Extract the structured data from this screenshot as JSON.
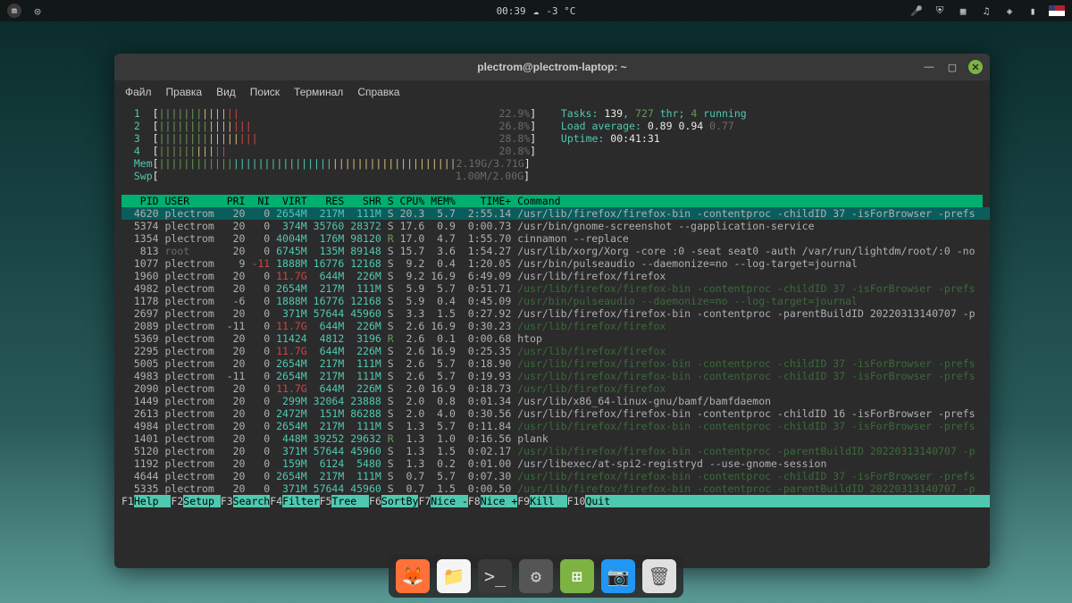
{
  "panel": {
    "time": "00:39",
    "weather": "-3 °C"
  },
  "window": {
    "title": "plectrom@plectrom-laptop: ~",
    "menu": [
      "Файл",
      "Правка",
      "Вид",
      "Поиск",
      "Терминал",
      "Справка"
    ]
  },
  "htop": {
    "cpus": [
      {
        "id": "1",
        "pct": "22.9%"
      },
      {
        "id": "2",
        "pct": "26.8%"
      },
      {
        "id": "3",
        "pct": "28.8%"
      },
      {
        "id": "4",
        "pct": "20.8%"
      }
    ],
    "mem_label": "Mem",
    "mem_used": "2.19G",
    "mem_total": "3.71G",
    "swp_label": "Swp",
    "swp_used": "1.00M",
    "swp_total": "2.00G",
    "tasks_label": "Tasks:",
    "tasks": "139",
    "threads": "727",
    "thr_label": "thr;",
    "running": "4",
    "running_label": "running",
    "la_label": "Load average:",
    "la1": "0.89",
    "la2": "0.94",
    "la3": "0.77",
    "uptime_label": "Uptime:",
    "uptime": "00:41:31",
    "header": [
      "  PID",
      "USER    ",
      "PRI",
      " NI",
      " VIRT",
      "  RES",
      "  SHR",
      "S",
      "CPU%",
      "MEM%",
      "  TIME+",
      "Command"
    ],
    "rows": [
      {
        "sel": true,
        "pid": "4620",
        "user": "plectrom",
        "pri": "20",
        "ni": "0",
        "virt": "2654M",
        "res": "217M",
        "shr": "111M",
        "s": "S",
        "cpu": "20.3",
        "mem": "5.7",
        "time": "2:55.14",
        "cmd": "/usr/lib/firefox/firefox-bin -contentproc -childID 37 -isForBrowser -prefs",
        "dim": false
      },
      {
        "pid": "5374",
        "user": "plectrom",
        "pri": "20",
        "ni": "0",
        "virt": "374M",
        "res": "35760",
        "shr": "28372",
        "s": "S",
        "cpu": "17.6",
        "mem": "0.9",
        "time": "0:00.73",
        "cmd": "/usr/bin/gnome-screenshot --gapplication-service"
      },
      {
        "pid": "1354",
        "user": "plectrom",
        "pri": "20",
        "ni": "0",
        "virt": "4004M",
        "res": "176M",
        "shr": "98120",
        "s": "R",
        "cpu": "17.0",
        "mem": "4.7",
        "time": "1:55.70",
        "cmd": "cinnamon --replace"
      },
      {
        "pid": "813",
        "user": "root",
        "pri": "20",
        "ni": "0",
        "virt": "6745M",
        "res": "135M",
        "shr": "89148",
        "s": "S",
        "cpu": "15.7",
        "mem": "3.6",
        "time": "1:54.27",
        "cmd": "/usr/lib/xorg/Xorg -core :0 -seat seat0 -auth /var/run/lightdm/root/:0 -no",
        "dimuser": true
      },
      {
        "pid": "1077",
        "user": "plectrom",
        "pri": "9",
        "ni": "-11",
        "virt": "1888M",
        "res": "16776",
        "shr": "12168",
        "s": "S",
        "cpu": "9.2",
        "mem": "0.4",
        "time": "1:20.05",
        "cmd": "/usr/bin/pulseaudio --daemonize=no --log-target=journal",
        "nired": true
      },
      {
        "pid": "1960",
        "user": "plectrom",
        "pri": "20",
        "ni": "0",
        "virt": "11.7G",
        "res": "644M",
        "shr": "226M",
        "s": "S",
        "cpu": "9.2",
        "mem": "16.9",
        "time": "6:49.09",
        "cmd": "/usr/lib/firefox/firefox",
        "virtred": true
      },
      {
        "pid": "4982",
        "user": "plectrom",
        "pri": "20",
        "ni": "0",
        "virt": "2654M",
        "res": "217M",
        "shr": "111M",
        "s": "S",
        "cpu": "5.9",
        "mem": "5.7",
        "time": "0:51.71",
        "cmd": "/usr/lib/firefox/firefox-bin -contentproc -childID 37 -isForBrowser -prefs",
        "dim": true
      },
      {
        "pid": "1178",
        "user": "plectrom",
        "pri": "-6",
        "ni": "0",
        "virt": "1888M",
        "res": "16776",
        "shr": "12168",
        "s": "S",
        "cpu": "5.9",
        "mem": "0.4",
        "time": "0:45.09",
        "cmd": "/usr/bin/pulseaudio --daemonize=no --log-target=journal",
        "dim": true
      },
      {
        "pid": "2697",
        "user": "plectrom",
        "pri": "20",
        "ni": "0",
        "virt": "371M",
        "res": "57644",
        "shr": "45960",
        "s": "S",
        "cpu": "3.3",
        "mem": "1.5",
        "time": "0:27.92",
        "cmd": "/usr/lib/firefox/firefox-bin -contentproc -parentBuildID 20220313140707 -p"
      },
      {
        "pid": "2089",
        "user": "plectrom",
        "pri": "-11",
        "ni": "0",
        "virt": "11.7G",
        "res": "644M",
        "shr": "226M",
        "s": "S",
        "cpu": "2.6",
        "mem": "16.9",
        "time": "0:30.23",
        "cmd": "/usr/lib/firefox/firefox",
        "dim": true,
        "virtred": true
      },
      {
        "pid": "5369",
        "user": "plectrom",
        "pri": "20",
        "ni": "0",
        "virt": "11424",
        "res": "4812",
        "shr": "3196",
        "s": "R",
        "cpu": "2.6",
        "mem": "0.1",
        "time": "0:00.68",
        "cmd": "htop"
      },
      {
        "pid": "2295",
        "user": "plectrom",
        "pri": "20",
        "ni": "0",
        "virt": "11.7G",
        "res": "644M",
        "shr": "226M",
        "s": "S",
        "cpu": "2.6",
        "mem": "16.9",
        "time": "0:25.35",
        "cmd": "/usr/lib/firefox/firefox",
        "dim": true,
        "virtred": true
      },
      {
        "pid": "5005",
        "user": "plectrom",
        "pri": "20",
        "ni": "0",
        "virt": "2654M",
        "res": "217M",
        "shr": "111M",
        "s": "S",
        "cpu": "2.6",
        "mem": "5.7",
        "time": "0:18.90",
        "cmd": "/usr/lib/firefox/firefox-bin -contentproc -childID 37 -isForBrowser -prefs",
        "dim": true
      },
      {
        "pid": "4983",
        "user": "plectrom",
        "pri": "-11",
        "ni": "0",
        "virt": "2654M",
        "res": "217M",
        "shr": "111M",
        "s": "S",
        "cpu": "2.6",
        "mem": "5.7",
        "time": "0:19.93",
        "cmd": "/usr/lib/firefox/firefox-bin -contentproc -childID 37 -isForBrowser -prefs",
        "dim": true
      },
      {
        "pid": "2090",
        "user": "plectrom",
        "pri": "20",
        "ni": "0",
        "virt": "11.7G",
        "res": "644M",
        "shr": "226M",
        "s": "S",
        "cpu": "2.0",
        "mem": "16.9",
        "time": "0:18.73",
        "cmd": "/usr/lib/firefox/firefox",
        "dim": true,
        "virtred": true
      },
      {
        "pid": "1449",
        "user": "plectrom",
        "pri": "20",
        "ni": "0",
        "virt": "299M",
        "res": "32064",
        "shr": "23888",
        "s": "S",
        "cpu": "2.0",
        "mem": "0.8",
        "time": "0:01.34",
        "cmd": "/usr/lib/x86_64-linux-gnu/bamf/bamfdaemon"
      },
      {
        "pid": "2613",
        "user": "plectrom",
        "pri": "20",
        "ni": "0",
        "virt": "2472M",
        "res": "151M",
        "shr": "86288",
        "s": "S",
        "cpu": "2.0",
        "mem": "4.0",
        "time": "0:30.56",
        "cmd": "/usr/lib/firefox/firefox-bin -contentproc -childID 16 -isForBrowser -prefs"
      },
      {
        "pid": "4984",
        "user": "plectrom",
        "pri": "20",
        "ni": "0",
        "virt": "2654M",
        "res": "217M",
        "shr": "111M",
        "s": "S",
        "cpu": "1.3",
        "mem": "5.7",
        "time": "0:11.84",
        "cmd": "/usr/lib/firefox/firefox-bin -contentproc -childID 37 -isForBrowser -prefs",
        "dim": true
      },
      {
        "pid": "1401",
        "user": "plectrom",
        "pri": "20",
        "ni": "0",
        "virt": "448M",
        "res": "39252",
        "shr": "29632",
        "s": "R",
        "cpu": "1.3",
        "mem": "1.0",
        "time": "0:16.56",
        "cmd": "plank"
      },
      {
        "pid": "5120",
        "user": "plectrom",
        "pri": "20",
        "ni": "0",
        "virt": "371M",
        "res": "57644",
        "shr": "45960",
        "s": "S",
        "cpu": "1.3",
        "mem": "1.5",
        "time": "0:02.17",
        "cmd": "/usr/lib/firefox/firefox-bin -contentproc -parentBuildID 20220313140707 -p",
        "dim": true
      },
      {
        "pid": "1192",
        "user": "plectrom",
        "pri": "20",
        "ni": "0",
        "virt": "159M",
        "res": "6124",
        "shr": "5480",
        "s": "S",
        "cpu": "1.3",
        "mem": "0.2",
        "time": "0:01.00",
        "cmd": "/usr/libexec/at-spi2-registryd --use-gnome-session"
      },
      {
        "pid": "4644",
        "user": "plectrom",
        "pri": "20",
        "ni": "0",
        "virt": "2654M",
        "res": "217M",
        "shr": "111M",
        "s": "S",
        "cpu": "0.7",
        "mem": "5.7",
        "time": "0:07.30",
        "cmd": "/usr/lib/firefox/firefox-bin -contentproc -childID 37 -isForBrowser -prefs",
        "dim": true
      },
      {
        "pid": "5335",
        "user": "plectrom",
        "pri": "20",
        "ni": "0",
        "virt": "371M",
        "res": "57644",
        "shr": "45960",
        "s": "S",
        "cpu": "0.7",
        "mem": "1.5",
        "time": "0:00.50",
        "cmd": "/usr/lib/firefox/firefox-bin -contentproc -parentBuildID 20220313140707 -p",
        "dim": true
      }
    ],
    "fkeys": [
      {
        "k": "F1",
        "l": "Help"
      },
      {
        "k": "F2",
        "l": "Setup"
      },
      {
        "k": "F3",
        "l": "Search"
      },
      {
        "k": "F4",
        "l": "Filter"
      },
      {
        "k": "F5",
        "l": "Tree"
      },
      {
        "k": "F6",
        "l": "SortBy"
      },
      {
        "k": "F7",
        "l": "Nice -"
      },
      {
        "k": "F8",
        "l": "Nice +"
      },
      {
        "k": "F9",
        "l": "Kill"
      },
      {
        "k": "F10",
        "l": "Quit"
      }
    ]
  }
}
